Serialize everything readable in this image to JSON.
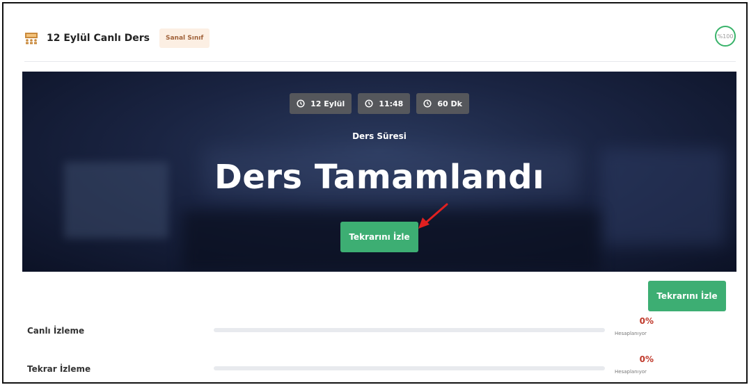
{
  "header": {
    "title": "12 Eylül Canlı Ders",
    "badge": "Sanal Sınıf",
    "progress_label": "%100",
    "progress_value": 100,
    "icon": "classroom-icon"
  },
  "hero": {
    "chips": [
      {
        "icon": "clock-icon",
        "label": "12 Eylül"
      },
      {
        "icon": "clock-icon",
        "label": "11:48"
      },
      {
        "icon": "clock-icon",
        "label": "60 Dk"
      }
    ],
    "duration_label": "Ders Süresi",
    "status_text": "Ders Tamamlandı",
    "replay_button": "Tekrarını İzle"
  },
  "side_button": "Tekrarını İzle",
  "stats": [
    {
      "label": "Canlı İzleme",
      "percent": "0%",
      "status": "Hesaplanıyor",
      "value": 0
    },
    {
      "label": "Tekrar İzleme",
      "percent": "0%",
      "status": "Hesaplanıyor",
      "value": 0
    }
  ],
  "colors": {
    "accent_green": "#3dae73",
    "percent_red": "#c0392b",
    "badge_text": "#a0623a",
    "badge_bg": "#fcefe3",
    "arrow_red": "#e02020"
  }
}
